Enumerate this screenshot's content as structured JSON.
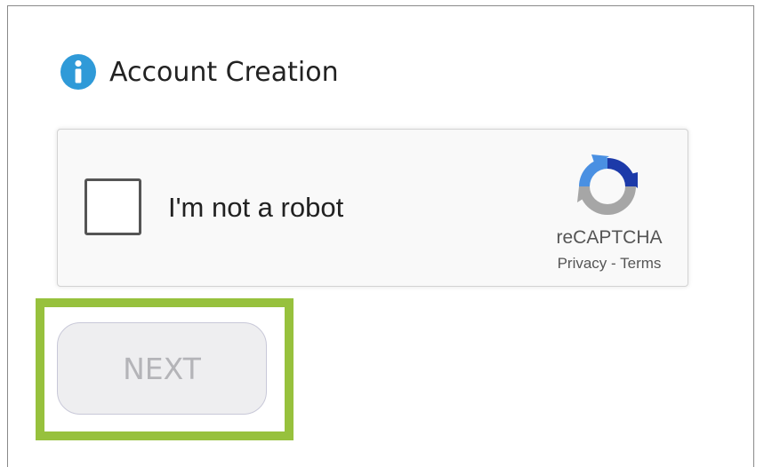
{
  "header": {
    "icon": "info-icon",
    "title": "Account Creation"
  },
  "captcha": {
    "checkbox_label": "I'm not a robot",
    "checked": false,
    "logo_icon": "recaptcha-logo-icon",
    "brand": "reCAPTCHA",
    "privacy_link": "Privacy",
    "separator": " - ",
    "terms_link": "Terms"
  },
  "actions": {
    "next_label": "NEXT",
    "next_disabled": true
  },
  "colors": {
    "info_icon": "#2f9ad8",
    "highlight": "#97c13d",
    "recaptcha_blue": "#1c3aa9",
    "recaptcha_light_blue": "#4a90e2",
    "recaptcha_gray": "#a6a6a6"
  }
}
